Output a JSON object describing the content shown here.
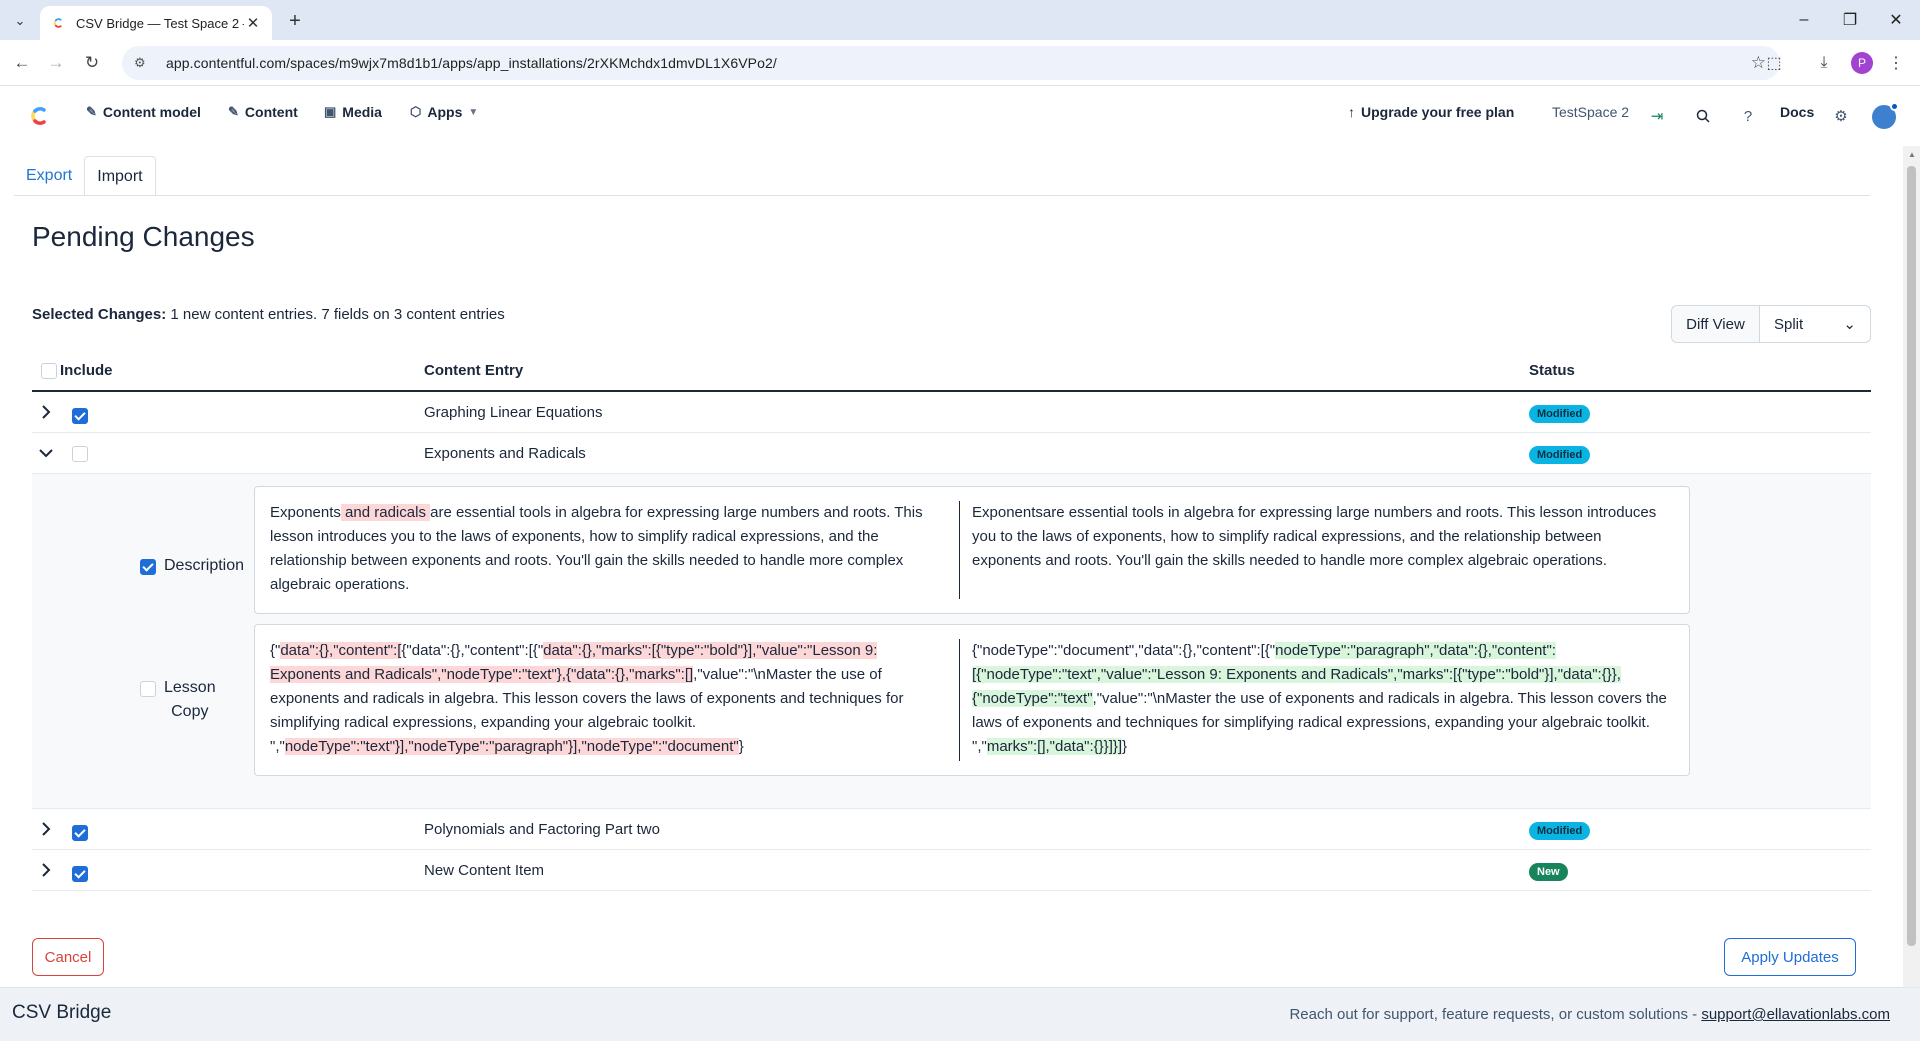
{
  "browser": {
    "tab_title": "CSV Bridge — Test Space 2 — C",
    "url": "app.contentful.com/spaces/m9wjx7m8d1b1/apps/app_installations/2rXKMchdx1dmvDL1X6VPo2/",
    "profile_initial": "P"
  },
  "nav": {
    "content_model": "Content model",
    "content": "Content",
    "media": "Media",
    "apps": "Apps",
    "upgrade": "Upgrade your free plan",
    "space": "TestSpace 2",
    "docs": "Docs"
  },
  "tabs": {
    "export": "Export",
    "import": "Import"
  },
  "page": {
    "title": "Pending Changes",
    "selected_label": "Selected Changes:",
    "selected_text": "1 new content entries. 7 fields on 3 content entries",
    "diff_view_label": "Diff View",
    "diff_view_value": "Split"
  },
  "table": {
    "headers": {
      "include": "Include",
      "entry": "Content Entry",
      "status": "Status"
    },
    "rows": [
      {
        "name": "Graphing Linear Equations",
        "status": "Modified"
      },
      {
        "name": "Exponents and Radicals",
        "status": "Modified"
      },
      {
        "name": "Polynomials and Factoring Part two",
        "status": "Modified"
      },
      {
        "name": "New Content Item",
        "status": "New"
      }
    ]
  },
  "fields": {
    "description": {
      "label": "Description",
      "left_pre": "Exponents",
      "left_del": " and radicals ",
      "left_post": "are essential tools in algebra for expressing large numbers and roots. This lesson introduces you to the laws of exponents, how to simplify radical expressions, and the relationship between exponents and roots. You'll gain the skills needed to handle more complex algebraic operations.",
      "right": "Exponentsare essential tools in algebra for expressing large numbers and roots. This lesson introduces you to the laws of exponents, how to simplify radical expressions, and the relationship between exponents and roots. You'll gain the skills needed to handle more complex algebraic operations."
    },
    "lesson_copy": {
      "label_line1": "Lesson",
      "label_line2": "Copy",
      "left": [
        {
          "t": "{\"",
          "d": false
        },
        {
          "t": "data\":{},\"content\":[",
          "d": true
        },
        {
          "t": "{\"data\":{},\"content\":[{\"",
          "d": false
        },
        {
          "t": "data\":{},\"marks\":[{\"type\":\"bold\"}],\"value\":\"Lesson 9: Exponents and Radicals\",\"nodeType\":\"text\"},{\"data\":{},\"marks\":[]",
          "d": true
        },
        {
          "t": ",\"value\":\"\\nMaster the use of exponents and radicals in algebra. This lesson covers the laws of exponents and techniques for simplifying radical expressions, expanding your algebraic toolkit. \",\"",
          "d": false
        },
        {
          "t": "nodeType\":\"text\"}],\"nodeType\":\"paragraph\"}],\"nodeType\":\"document\"",
          "d": true
        },
        {
          "t": "}",
          "d": false
        }
      ],
      "right": [
        {
          "t": "{\"nodeType\":\"document\",\"data\":{},\"content\":[{\"",
          "d": false
        },
        {
          "t": "nodeType\":\"paragraph\",\"data\":{},\"content\":[{\"nodeType\":\"text\",\"value\":\"Lesson 9: Exponents and Radicals\",\"marks\":[{\"type\":\"bold\"}],\"data\":{}},{\"nodeType\":\"text\"",
          "d": true
        },
        {
          "t": ",\"value\":\"\\nMaster the use of exponents and radicals in algebra. This lesson covers the laws of exponents and techniques for simplifying radical expressions, expanding your algebraic toolkit. \",\"",
          "d": false
        },
        {
          "t": "marks\":[],\"data\":{}}]}]",
          "d": true
        },
        {
          "t": "}",
          "d": false
        }
      ]
    }
  },
  "buttons": {
    "cancel": "Cancel",
    "apply": "Apply Updates"
  },
  "footer": {
    "brand": "CSV Bridge",
    "support_text": "Reach out for support, feature requests, or custom solutions -",
    "support_email": "support@ellavationlabs.com"
  }
}
